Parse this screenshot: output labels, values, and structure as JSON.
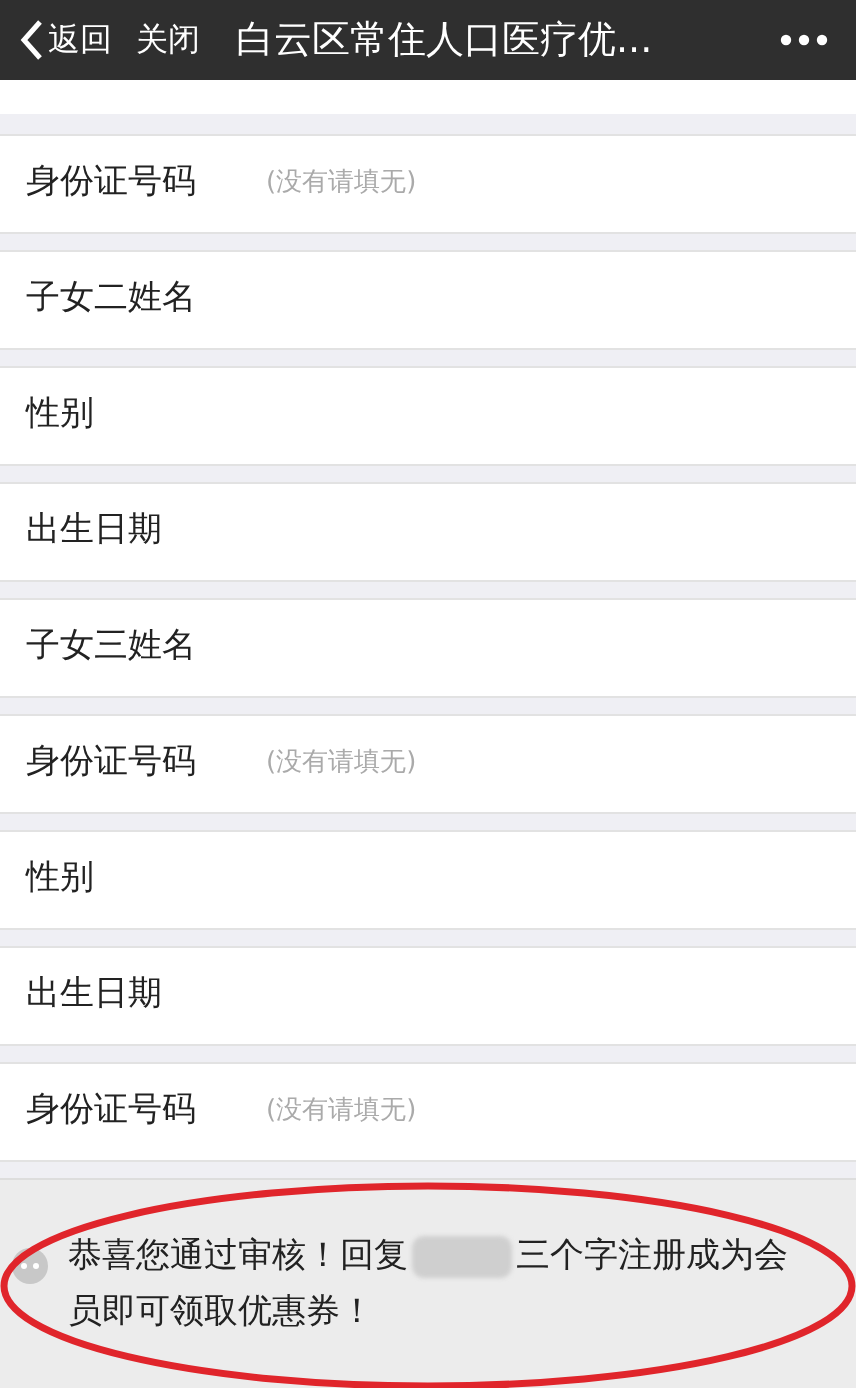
{
  "nav": {
    "back": "返回",
    "close": "关闭",
    "title": "白云区常住人口医疗优..."
  },
  "rows": [
    {
      "label": "身份证号码",
      "placeholder": "(没有请填无)"
    },
    {
      "label": "子女二姓名"
    },
    {
      "label": "性别"
    },
    {
      "label": "出生日期"
    },
    {
      "label": "子女三姓名"
    },
    {
      "label": "身份证号码",
      "placeholder": "(没有请填无)"
    },
    {
      "label": "性别"
    },
    {
      "label": "出生日期"
    },
    {
      "label": "身份证号码",
      "placeholder": "(没有请填无)"
    }
  ],
  "message": {
    "text_before": "恭喜您通过审核！回复",
    "redacted": true,
    "text_after": "三个字注册成为会",
    "text_line2": "员即可领取优惠券！",
    "circled": true
  }
}
